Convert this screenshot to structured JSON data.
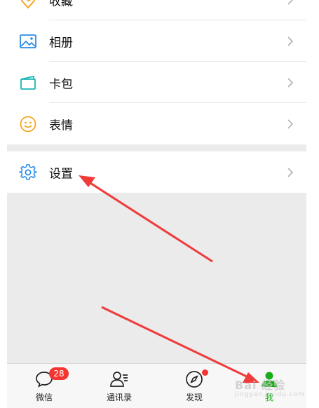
{
  "menu": {
    "items": [
      {
        "label": "收藏",
        "icon": "favorites-icon"
      },
      {
        "label": "相册",
        "icon": "album-icon"
      },
      {
        "label": "卡包",
        "icon": "card-wallet-icon"
      },
      {
        "label": "表情",
        "icon": "emoji-icon"
      }
    ],
    "settings": {
      "label": "设置",
      "icon": "settings-gear-icon"
    }
  },
  "tabbar": {
    "tabs": [
      {
        "label": "微信",
        "icon": "chat-bubble-icon",
        "badge": "28"
      },
      {
        "label": "通讯录",
        "icon": "contacts-icon"
      },
      {
        "label": "发现",
        "icon": "compass-icon"
      },
      {
        "label": "我",
        "icon": "me-person-icon"
      }
    ]
  },
  "watermark": {
    "text": "Bai 经验",
    "sub": "jingyan.baidu.com"
  },
  "colors": {
    "active_tab": "#1aad19",
    "badge": "#f43530",
    "annotation_arrow": "#f03b3b"
  }
}
